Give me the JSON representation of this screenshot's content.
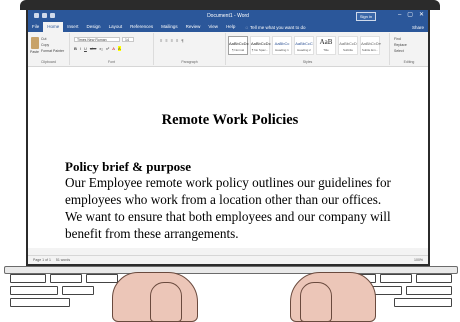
{
  "window": {
    "title": "Document1 - Word",
    "signin_label": "Sign in",
    "controls": [
      "–",
      "▢",
      "✕"
    ]
  },
  "menu": {
    "tabs": [
      "File",
      "Home",
      "Insert",
      "Design",
      "Layout",
      "References",
      "Mailings",
      "Review",
      "View",
      "Help"
    ],
    "active_tab": "Home",
    "tell_me": "Tell me what you want to do",
    "share": "Share"
  },
  "ribbon": {
    "clipboard": {
      "label": "Clipboard",
      "paste": "Paste",
      "cut": "Cut",
      "copy": "Copy",
      "format_painter": "Format Painter"
    },
    "font": {
      "label": "Font",
      "family": "Times New Roman",
      "size": "14",
      "buttons": [
        "B",
        "I",
        "U",
        "abc",
        "x₂",
        "x²",
        "A",
        "A"
      ]
    },
    "paragraph": {
      "label": "Paragraph",
      "buttons": [
        "≡",
        "≡",
        "≡",
        "≡",
        "¶"
      ]
    },
    "styles": {
      "label": "Styles",
      "items": [
        {
          "sample": "AaBbCcDc",
          "name": "¶ Normal"
        },
        {
          "sample": "AaBbCcDc",
          "name": "¶ No Spac..."
        },
        {
          "sample": "AaBbCc",
          "name": "Heading 1"
        },
        {
          "sample": "AaBbCcC",
          "name": "Heading 2"
        },
        {
          "sample": "AaB",
          "name": "Title"
        },
        {
          "sample": "AaBbCcD",
          "name": "Subtitle"
        },
        {
          "sample": "AaBbCcDe",
          "name": "Subtle Em..."
        }
      ]
    },
    "editing": {
      "label": "Editing",
      "find": "Find",
      "replace": "Replace",
      "select": "Select"
    }
  },
  "document": {
    "title": "Remote Work Policies",
    "heading": "Policy brief & purpose",
    "body": "Our Employee remote work policy outlines our guidelines for employees who work from a location other than our offices. We want to ensure that both employees and our company will benefit from these arrangements."
  },
  "status": {
    "page": "Page 1 of 1",
    "words": "51 words",
    "zoom": "100%"
  },
  "colors": {
    "accent": "#2b579a",
    "ribbon_bg": "#f3f3f3",
    "skin": "#ecc6b8",
    "outline": "#2b2b2b"
  }
}
